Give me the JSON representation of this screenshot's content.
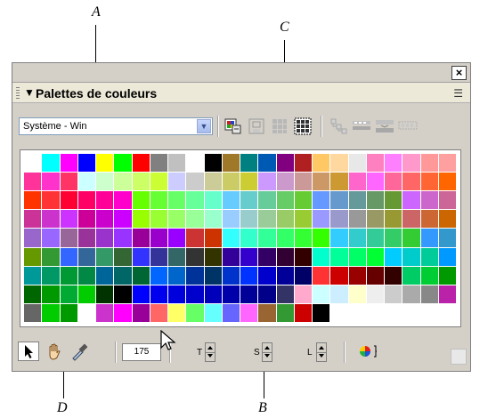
{
  "callouts": {
    "a": "A",
    "b": "B",
    "c": "C",
    "d": "D"
  },
  "panel": {
    "close_glyph": "×",
    "title": "Palettes de couleurs",
    "collapse_glyph": "▼",
    "menu_glyph": "☰"
  },
  "toolbar": {
    "palette_value": "Système - Win",
    "palette_options_icon": "chevron-down-icon"
  },
  "bottom": {
    "color_count": "175",
    "hue_label": "T",
    "saturation_label": "S",
    "lightness_label": "L"
  },
  "palette": {
    "selected_index": 223,
    "columns": 24,
    "rows": 9,
    "colors": [
      "#ffffff",
      "#00ffff",
      "#ff00ff",
      "#0000ff",
      "#ffff00",
      "#00ff00",
      "#ff0000",
      "#808080",
      "#c0c0c0",
      "#ffffff",
      "#000000",
      "#a0782a",
      "#008080",
      "#0059b3",
      "#800080",
      "#b02020",
      "#ffc864",
      "#ffd8a0",
      "#e8e8e8",
      "#ff80c0",
      "#ff80ff",
      "#ff99cc",
      "#ff9999",
      "#ffa0a0",
      "#ff3399",
      "#ff33cc",
      "#ff3366",
      "#ccffff",
      "#ccffcc",
      "#ccff99",
      "#ccff66",
      "#ccff33",
      "#ccccff",
      "#cccccc",
      "#cccc99",
      "#cccc66",
      "#cccc33",
      "#cc99ff",
      "#cc99cc",
      "#cc9999",
      "#cc9966",
      "#cc9933",
      "#ff66cc",
      "#ff66ff",
      "#ff6699",
      "#ff6666",
      "#ff6633",
      "#ff6600",
      "#ff3300",
      "#ff3333",
      "#ff0033",
      "#ff0066",
      "#ff0099",
      "#ff00cc",
      "#66ff00",
      "#66ff33",
      "#66ff66",
      "#66ff99",
      "#66ffcc",
      "#66ccff",
      "#66cccc",
      "#66cc99",
      "#66cc66",
      "#66cc33",
      "#6699ff",
      "#6699cc",
      "#669999",
      "#669966",
      "#669933",
      "#cc66ff",
      "#cc66cc",
      "#cc6699",
      "#cc3399",
      "#cc33cc",
      "#cc33ff",
      "#cc0099",
      "#cc00cc",
      "#cc00ff",
      "#99ff00",
      "#99ff33",
      "#99ff66",
      "#99ff99",
      "#99ffcc",
      "#99ccff",
      "#99cccc",
      "#99cc99",
      "#99cc66",
      "#99cc33",
      "#9999ff",
      "#9999cc",
      "#999999",
      "#999966",
      "#999933",
      "#cc6666",
      "#cc6633",
      "#cc6600",
      "#9966cc",
      "#9966ff",
      "#996699",
      "#993399",
      "#9933cc",
      "#9933ff",
      "#990099",
      "#9900cc",
      "#9900ff",
      "#cc3333",
      "#cc3300",
      "#33ffff",
      "#33ffcc",
      "#33ff99",
      "#33ff66",
      "#33ff33",
      "#33ff00",
      "#33ccff",
      "#33cccc",
      "#33cc99",
      "#33cc66",
      "#33cc33",
      "#3399ff",
      "#3399cc",
      "#669900",
      "#339933",
      "#3366ff",
      "#336699",
      "#339966",
      "#336633",
      "#3333ff",
      "#333399",
      "#336666",
      "#333333",
      "#333300",
      "#330099",
      "#3300cc",
      "#330066",
      "#330033",
      "#330000",
      "#00ffcc",
      "#00ff99",
      "#00ff66",
      "#00ff33",
      "#00ccff",
      "#00cccc",
      "#00cc99",
      "#0099ff",
      "#009999",
      "#009966",
      "#009933",
      "#008844",
      "#006699",
      "#006666",
      "#006633",
      "#0066ff",
      "#0066cc",
      "#003399",
      "#003366",
      "#0033cc",
      "#0033ff",
      "#0000cc",
      "#000099",
      "#000066",
      "#ff3333",
      "#cc0000",
      "#990000",
      "#660000",
      "#330000",
      "#00cc66",
      "#00cc33",
      "#009900",
      "#006600",
      "#009900",
      "#00aa33",
      "#00cc00",
      "#003300",
      "#000000",
      "#0000ff",
      "#0000ee",
      "#0000dd",
      "#0000cc",
      "#0000bb",
      "#0000aa",
      "#000099",
      "#000088",
      "#333366",
      "#ffaacc",
      "#ccffff",
      "#cceeff",
      "#ffffcc",
      "#eeeeee",
      "#cccccc",
      "#aaaaaa",
      "#888888",
      "#bb22aa",
      "#666666",
      "#00cc00",
      "#009900",
      "#ffffff",
      "#cc33cc",
      "#ff00ff",
      "#990099",
      "#ff6666",
      "#ffff66",
      "#66ff66",
      "#66ffff",
      "#6666ff",
      "#ff66ff",
      "#996633",
      "#339933",
      "#cc0000",
      "#000000",
      "#ffffff",
      "#ffffff",
      "#ffffff",
      "#ffffff",
      "#ffffff",
      "#ffffff",
      "#ffffff"
    ]
  }
}
